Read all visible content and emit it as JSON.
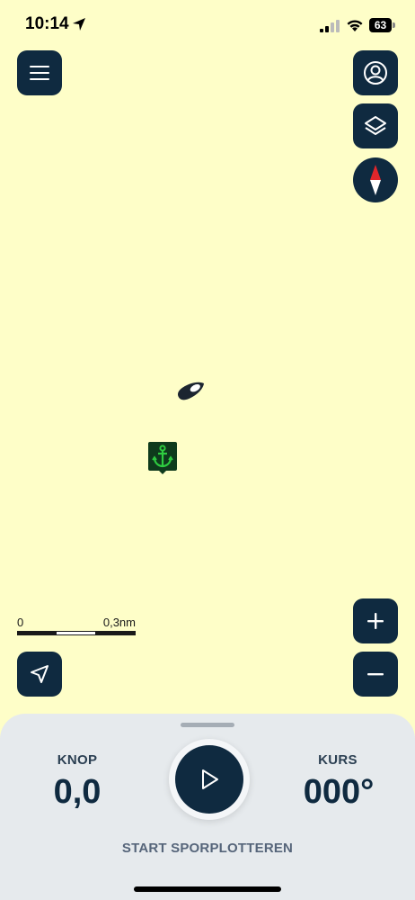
{
  "status_bar": {
    "time": "10:14",
    "battery_level": "63"
  },
  "map": {
    "background_color": "#fefec8",
    "scale": {
      "start_label": "0",
      "end_label": "0,3nm"
    }
  },
  "icons": {
    "menu": "menu-icon",
    "profile": "user-icon",
    "layers": "layers-icon",
    "compass": "compass-icon",
    "vessel": "boat-icon",
    "anchor": "anchor-icon",
    "locate": "navigation-arrow-icon",
    "zoom_in": "plus-icon",
    "zoom_out": "minus-icon",
    "play": "play-icon"
  },
  "colors": {
    "button_bg": "#0f2a40",
    "anchor_green": "#2ecc40",
    "anchor_bg": "#0e3a1c",
    "compass_red": "#e0262b",
    "panel_bg": "#e6eaed"
  },
  "panel": {
    "speed_label": "KNOP",
    "speed_value": "0,0",
    "course_label": "KURS",
    "course_value": "000°",
    "start_label": "START SPORPLOTTEREN"
  }
}
